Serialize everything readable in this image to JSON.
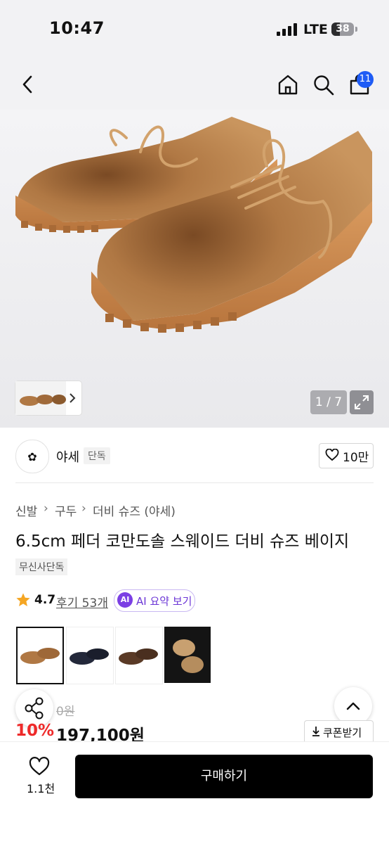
{
  "status_bar": {
    "time": "10:47",
    "network": "LTE",
    "battery": "38",
    "battery_level": 0.38
  },
  "header": {
    "back_icon": "chevron-left-icon",
    "home_icon": "home-icon",
    "search_icon": "search-icon",
    "cart_icon": "cart-icon",
    "cart_count": "11"
  },
  "gallery": {
    "page": "1 / 7",
    "current": 1,
    "total": 7
  },
  "brand": {
    "name": "야세",
    "tag": "단독",
    "likes": "10만"
  },
  "breadcrumb": [
    "신발",
    "구두",
    "더비 슈즈 (야세)"
  ],
  "product": {
    "title": "6.5cm 페더 코만도솔 스웨이드 더비 슈즈 베이지",
    "badge": "무신사단독",
    "rating": "4.7",
    "reviews": "후기 53개",
    "ai_badge": "AI",
    "ai_summary": "AI 요약 보기",
    "original_price": "0원",
    "discount": "10%",
    "price": "197,100원",
    "coupon": "쿠폰받기"
  },
  "colors": {
    "accent": "#1f5cf5",
    "discount": "#ee2a2a",
    "ai": "#7b3fe4",
    "star": "#f5a623"
  },
  "bottom_bar": {
    "wish_count": "1.1천",
    "buy_label": "구매하기"
  }
}
